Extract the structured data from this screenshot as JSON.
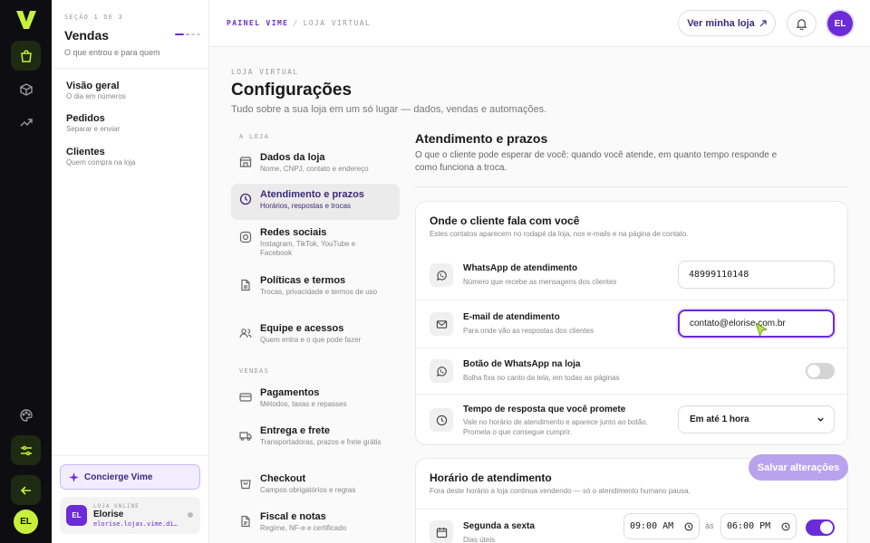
{
  "sidebar": {
    "eyebrow": "SEÇÃO 1 DE 3",
    "title": "Vendas",
    "subtitle": "O que entrou e para quem",
    "items": [
      {
        "label": "Visão geral",
        "sub": "O dia em números"
      },
      {
        "label": "Pedidos",
        "sub": "Separar e enviar"
      },
      {
        "label": "Clientes",
        "sub": "Quem compra na loja"
      }
    ],
    "concierge": "Concierge Vime",
    "store": {
      "badge": "EL",
      "eyebrow": "LOJA ONLINE",
      "name": "Elorise",
      "url": "elorise.lojas.vime.digital"
    },
    "user_initials": "EL"
  },
  "header": {
    "crumb_1": "PAINEL VIME",
    "crumb_sep": "/",
    "crumb_2": "LOJA VIRTUAL",
    "view_store": "Ver minha loja",
    "avatar": "EL"
  },
  "page": {
    "eyebrow": "LOJA VIRTUAL",
    "title": "Configurações",
    "subtitle": "Tudo sobre a sua loja em um só lugar — dados, vendas e automações."
  },
  "settings_nav": {
    "section_store": "A LOJA",
    "section_sales": "VENDAS",
    "store_items": [
      {
        "label": "Dados da loja",
        "sub": "Nome, CNPJ, contato e endereço"
      },
      {
        "label": "Atendimento e prazos",
        "sub": "Horários, respostas e trocas"
      },
      {
        "label": "Redes sociais",
        "sub": "Instagram, TikTok, YouTube e Facebook"
      },
      {
        "label": "Políticas e termos",
        "sub": "Trocas, privacidade e termos de uso"
      },
      {
        "label": "Equipe e acessos",
        "sub": "Quem entra e o que pode fazer"
      }
    ],
    "sales_items": [
      {
        "label": "Pagamentos",
        "sub": "Métodos, taxas e repasses"
      },
      {
        "label": "Entrega e frete",
        "sub": "Transportadoras, prazos e frete grátis"
      },
      {
        "label": "Checkout",
        "sub": "Campos obrigatórios e regras"
      },
      {
        "label": "Fiscal e notas",
        "sub": "Regime, NF-e e certificado"
      }
    ]
  },
  "content": {
    "title": "Atendimento e prazos",
    "subtitle": "O que o cliente pode esperar de você: quando você atende, em quanto tempo responde e como funciona a troca.",
    "contact_card": {
      "title": "Onde o cliente fala com você",
      "subtitle": "Estes contatos aparecem no rodapé da loja, nos e-mails e na página de contato.",
      "whatsapp": {
        "label": "WhatsApp de atendimento",
        "desc": "Número que recebe as mensagens dos clientes",
        "value": "48999110148"
      },
      "email": {
        "label": "E-mail de atendimento",
        "desc": "Para onde vão as respostas dos clientes",
        "value": "contato@elorise.com.br"
      },
      "wa_button": {
        "label": "Botão de WhatsApp na loja",
        "desc": "Bolha fixa no canto da tela, em todas as páginas",
        "enabled": false
      },
      "response": {
        "label": "Tempo de resposta que você promete",
        "desc": "Vale no horário de atendimento e aparece junto ao botão. Prometa o que consegue cumprir.",
        "value": "Em até 1 hora"
      }
    },
    "hours_card": {
      "title": "Horário de atendimento",
      "subtitle": "Fora deste horário a loja continua vendendo — só o atendimento humano pausa.",
      "row": {
        "label": "Segunda a sexta",
        "desc": "Dias úteis",
        "from": "09:00 AM",
        "sep": "às",
        "to": "06:00 PM",
        "enabled": true
      }
    },
    "save": "Salvar alterações"
  },
  "colors": {
    "accent": "#6c2bd9",
    "lime": "#c6f03a",
    "rail": "#0e0e12"
  }
}
